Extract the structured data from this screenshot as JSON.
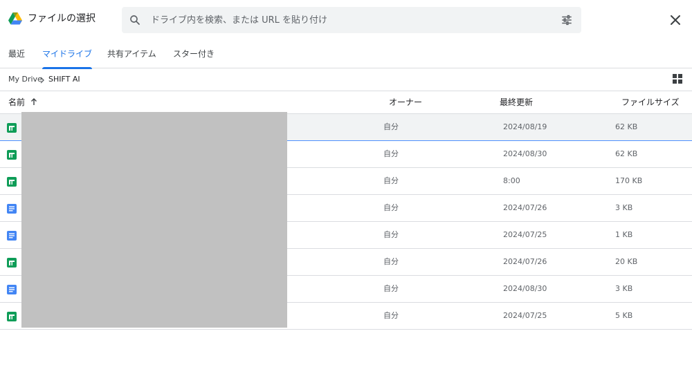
{
  "header": {
    "title": "ファイルの選択",
    "logo_icon": "google-drive-logo",
    "search_placeholder": "ドライブ内を検索、または URL を貼り付け",
    "search_value": "",
    "search_icon": "search-icon",
    "filter_icon": "tune-icon",
    "close_icon": "close-icon"
  },
  "tabs": [
    {
      "label": "最近",
      "active": false
    },
    {
      "label": "マイドライブ",
      "active": true
    },
    {
      "label": "共有アイテム",
      "active": false
    },
    {
      "label": "スター付き",
      "active": false
    }
  ],
  "breadcrumb": {
    "items": [
      "My Drive",
      "SHIFT AI"
    ],
    "view_toggle_icon": "grid-view-icon"
  },
  "columns": {
    "name": "名前",
    "owner": "オーナー",
    "modified": "最終更新",
    "size": "ファイルサイズ",
    "sort_icon": "arrow-up-icon"
  },
  "files": [
    {
      "type": "sheets",
      "owner": "自分",
      "modified": "2024/08/19",
      "size": "62 KB",
      "selected": true
    },
    {
      "type": "sheets",
      "owner": "自分",
      "modified": "2024/08/30",
      "size": "62 KB",
      "selected": false
    },
    {
      "type": "sheets",
      "owner": "自分",
      "modified": "8:00",
      "size": "170 KB",
      "selected": false
    },
    {
      "type": "docs",
      "owner": "自分",
      "modified": "2024/07/26",
      "size": "3 KB",
      "selected": false
    },
    {
      "type": "docs",
      "owner": "自分",
      "modified": "2024/07/25",
      "size": "1 KB",
      "selected": false
    },
    {
      "type": "sheets",
      "owner": "自分",
      "modified": "2024/07/26",
      "size": "20 KB",
      "selected": false
    },
    {
      "type": "docs",
      "owner": "自分",
      "modified": "2024/08/30",
      "size": "3 KB",
      "selected": false
    },
    {
      "type": "sheets",
      "owner": "自分",
      "modified": "2024/07/25",
      "size": "5 KB",
      "selected": false
    }
  ],
  "colors": {
    "accent": "#1a73e8",
    "sheets_green": "#0f9d58",
    "docs_blue": "#4285f4",
    "redaction": "#c1c1c1"
  }
}
